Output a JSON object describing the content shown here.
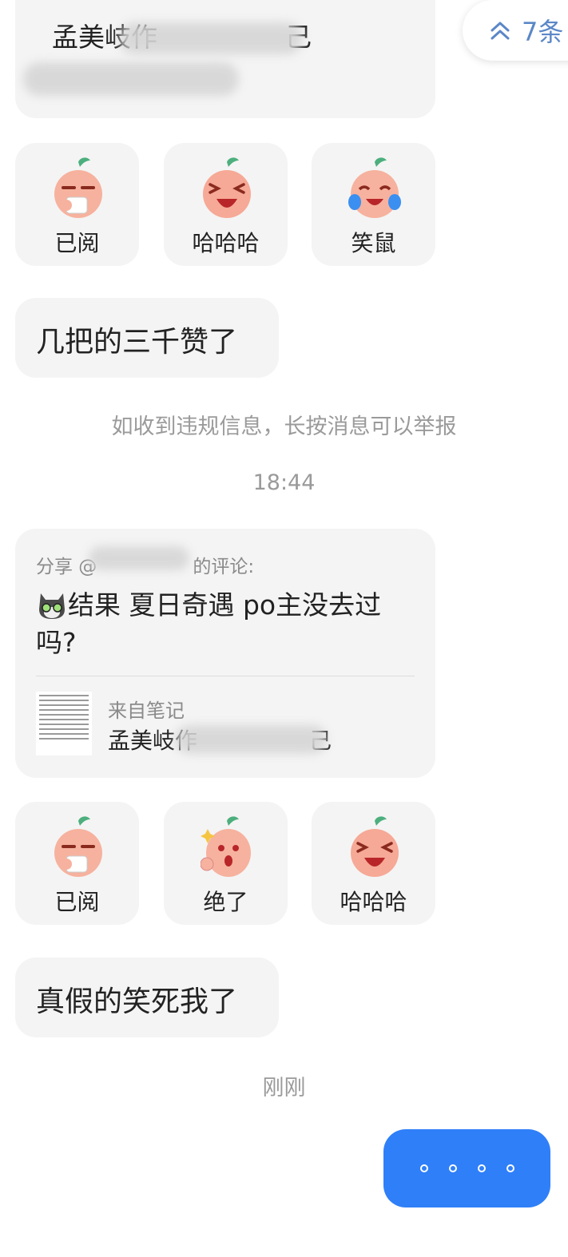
{
  "top_message": {
    "title": "孟美岐作",
    "title_tail": "己"
  },
  "unread_button": {
    "label": "7条",
    "icon": "double-chevron-up-icon"
  },
  "quick_replies_1": [
    {
      "label": "已阅",
      "icon": "peach-sip-icon"
    },
    {
      "label": "哈哈哈",
      "icon": "peach-laugh-icon"
    },
    {
      "label": "笑鼠",
      "icon": "peach-cry-laugh-icon"
    }
  ],
  "message_1": "几把的三千赞了",
  "system_notice": "如收到违规信息，长按消息可以举报",
  "timestamp_1": "18:44",
  "shared_comment": {
    "header_prefix": "分享 @",
    "header_suffix": "的评论:",
    "emoji_icon": "cat-avatar-icon",
    "text": "结果 夏日奇遇 po主没去过吗?",
    "source_label": "来自笔记",
    "source_title": "孟美岐作",
    "source_title_tail": "己"
  },
  "quick_replies_2": [
    {
      "label": "已阅",
      "icon": "peach-sip-icon"
    },
    {
      "label": "绝了",
      "icon": "peach-thumbs-up-icon"
    },
    {
      "label": "哈哈哈",
      "icon": "peach-laugh-icon"
    }
  ],
  "message_2": "真假的笑死我了",
  "timestamp_2": "刚刚",
  "colors": {
    "accent": "#2f7ff8",
    "bubble": "#f4f4f4",
    "muted": "#9a9a9a",
    "unread_text": "#5b87c7"
  }
}
